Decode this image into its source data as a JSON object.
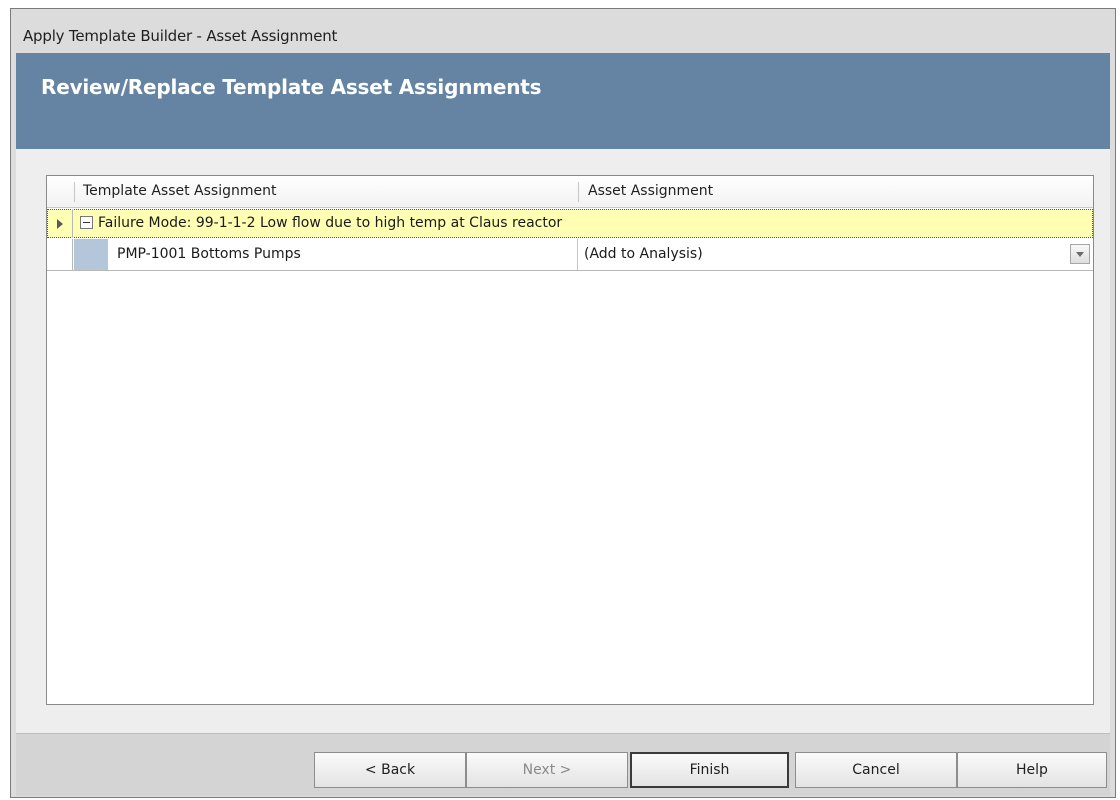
{
  "window": {
    "title": "Apply Template Builder - Asset Assignment"
  },
  "banner": {
    "heading": "Review/Replace Template Asset Assignments"
  },
  "grid": {
    "columns": [
      "Template Asset Assignment",
      "Asset Assignment"
    ],
    "group_row": {
      "label": "Failure Mode: 99-1-1-2 Low flow due to high temp at Claus reactor",
      "expanded": true
    },
    "rows": [
      {
        "template_asset": "PMP-1001 Bottoms Pumps",
        "asset_assignment": "(Add to Analysis)"
      }
    ]
  },
  "footer": {
    "back_label": "< Back",
    "next_label": "Next >",
    "finish_label": "Finish",
    "cancel_label": "Cancel",
    "help_label": "Help"
  }
}
